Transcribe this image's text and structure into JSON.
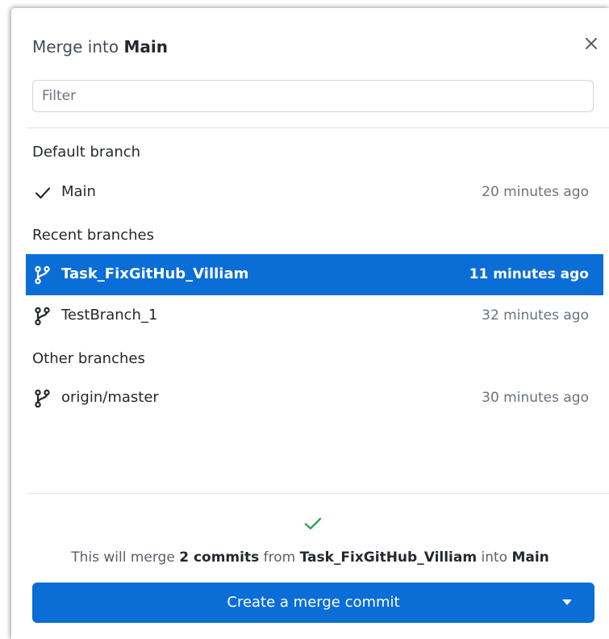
{
  "dialog": {
    "title_prefix": "Merge into",
    "title_branch": "Main"
  },
  "filter": {
    "placeholder": "Filter",
    "value": ""
  },
  "sections": {
    "default_label": "Default branch",
    "recent_label": "Recent branches",
    "other_label": "Other branches"
  },
  "branches": {
    "default": [
      {
        "name": "Main",
        "time": "20 minutes ago",
        "icon": "check-icon"
      }
    ],
    "recent": [
      {
        "name": "Task_FixGitHub_Villiam",
        "time": "11 minutes ago",
        "icon": "git-branch-icon",
        "selected": true
      },
      {
        "name": "TestBranch_1",
        "time": "32 minutes ago",
        "icon": "git-branch-icon",
        "selected": false
      }
    ],
    "other": [
      {
        "name": "origin/master",
        "time": "30 minutes ago",
        "icon": "git-branch-icon"
      }
    ]
  },
  "merge_info": {
    "prefix": "This will merge",
    "count": "2 commits",
    "from_word": "from",
    "source": "Task_FixGitHub_Villiam",
    "into_word": "into",
    "target": "Main"
  },
  "button": {
    "label": "Create a merge commit"
  },
  "colors": {
    "accent": "#0b6dd6",
    "success": "#2da44e",
    "text": "#24292e",
    "muted": "#6a737d"
  }
}
